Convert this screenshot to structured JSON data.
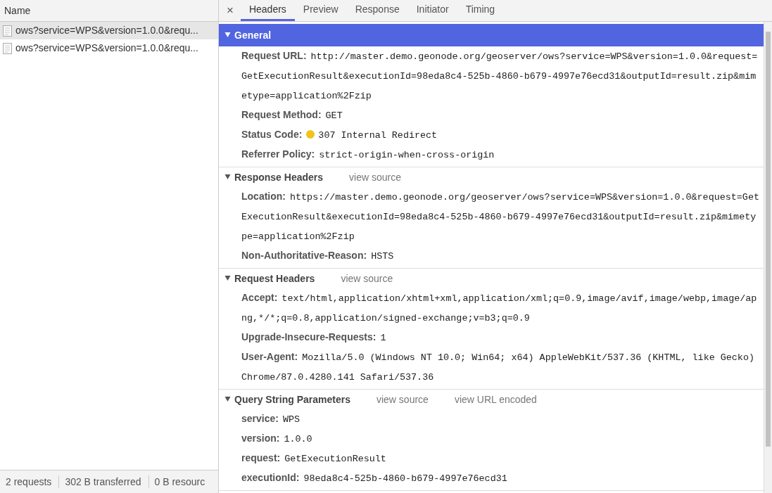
{
  "requests_panel": {
    "column_header": "Name",
    "items": [
      {
        "name": "ows?service=WPS&version=1.0.0&requ...",
        "selected": true
      },
      {
        "name": "ows?service=WPS&version=1.0.0&requ...",
        "selected": false
      }
    ]
  },
  "status_bar": [
    "2 requests",
    "302 B transferred",
    "0 B resourc"
  ],
  "tabs": [
    {
      "label": "Headers",
      "selected": true
    },
    {
      "label": "Preview",
      "selected": false
    },
    {
      "label": "Response",
      "selected": false
    },
    {
      "label": "Initiator",
      "selected": false
    },
    {
      "label": "Timing",
      "selected": false
    }
  ],
  "close_symbol": "×",
  "sections": [
    {
      "title": "General",
      "expanded": true,
      "highlighted": true,
      "rows": [
        {
          "name": "Request URL:",
          "value": "http://master.demo.geonode.org/geoserver/ows?service=WPS&version=1.0.0&request=GetExecutionResult&executionId=98eda8c4-525b-4860-b679-4997e76ecd31&outputId=result.zip&mimetype=application%2Fzip"
        },
        {
          "name": "Request Method:",
          "value": "GET"
        },
        {
          "name": "Status Code:",
          "value": "307 Internal Redirect",
          "color": "#f0c419"
        },
        {
          "name": "Referrer Policy:",
          "value": "strict-origin-when-cross-origin"
        }
      ]
    },
    {
      "title": "Response Headers",
      "expanded": true,
      "highlighted": false,
      "links": [
        "view source"
      ],
      "rows": [
        {
          "name": "Location:",
          "value": "https://master.demo.geonode.org/geoserver/ows?service=WPS&version=1.0.0&request=GetExecutionResult&executionId=98eda8c4-525b-4860-b679-4997e76ecd31&outputId=result.zip&mimetype=application%2Fzip"
        },
        {
          "name": "Non-Authoritative-Reason:",
          "value": "HSTS"
        }
      ]
    },
    {
      "title": "Request Headers",
      "expanded": true,
      "highlighted": false,
      "links": [
        "view source"
      ],
      "rows": [
        {
          "name": "Accept:",
          "value": "text/html,application/xhtml+xml,application/xml;q=0.9,image/avif,image/webp,image/apng,*/*;q=0.8,application/signed-exchange;v=b3;q=0.9"
        },
        {
          "name": "Upgrade-Insecure-Requests:",
          "value": "1"
        },
        {
          "name": "User-Agent:",
          "value": "Mozilla/5.0 (Windows NT 10.0; Win64; x64) AppleWebKit/537.36 (KHTML, like Gecko) Chrome/87.0.4280.141 Safari/537.36"
        }
      ]
    },
    {
      "title": "Query String Parameters",
      "expanded": true,
      "highlighted": false,
      "links": [
        "view source",
        "view URL encoded"
      ],
      "rows": [
        {
          "name": "service:",
          "value": "WPS"
        },
        {
          "name": "version:",
          "value": "1.0.0"
        },
        {
          "name": "request:",
          "value": "GetExecutionResult"
        },
        {
          "name": "executionId:",
          "value": "98eda8c4-525b-4860-b679-4997e76ecd31"
        }
      ]
    }
  ]
}
